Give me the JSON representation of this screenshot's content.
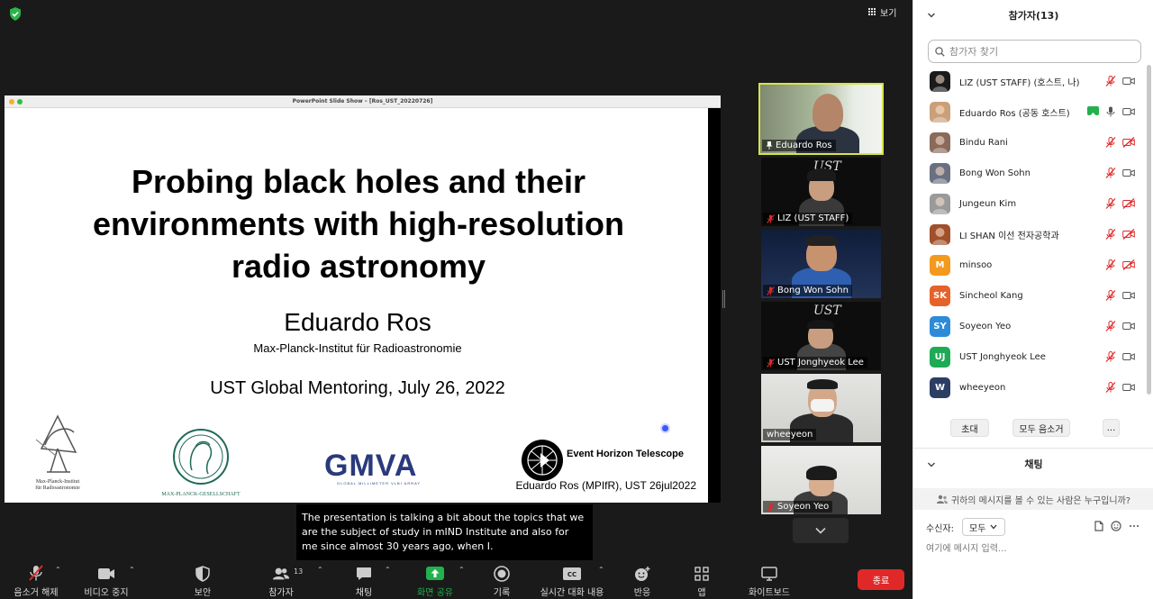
{
  "window": {
    "view_label": "보기"
  },
  "shared_screen": {
    "window_title": "PowerPoint Slide Show – [Ros_UST_20220726]",
    "slide": {
      "title": "Probing black holes and their environments with high-resolution radio astronomy",
      "author": "Eduardo Ros",
      "institute": "Max-Planck-Institut für Radioastronomie",
      "event": "UST Global Mentoring, July 26, 2022",
      "footer": "Eduardo Ros (MPIfR), UST 26jul2022",
      "logo_mpifr": "Max-Planck-Institut\nfür Radioastronomie",
      "logo_mpg": "MAX-PLANCK-GESELLSCHAFT",
      "logo_gmva": "GMVA",
      "logo_gmva_sub": "GLOBAL MILLIMETER VLBI ARRAY",
      "logo_eht": "Event Horizon Telescope"
    }
  },
  "video_tiles": [
    {
      "name": "Eduardo Ros",
      "muted": false,
      "pinned": true
    },
    {
      "name": "LIZ (UST STAFF)",
      "muted": true
    },
    {
      "name": "Bong Won Sohn",
      "muted": true
    },
    {
      "name": "UST Jonghyeok Lee",
      "muted": true
    },
    {
      "name": "wheeyeon",
      "muted": false
    },
    {
      "name": "Soyeon Yeo",
      "muted": true
    }
  ],
  "caption": "The presentation is talking a bit about the topics that we are the subject of study in mIND Institute and also for me since almost 30 years ago, when I.",
  "toolbar": {
    "mute": "음소거 해제",
    "video": "비디오 중지",
    "security": "보안",
    "participants": "참가자",
    "participants_count": "13",
    "chat": "채팅",
    "share": "화면 공유",
    "record": "기록",
    "live_transcript": "실시간 대화 내용",
    "reactions": "반응",
    "apps": "앱",
    "whiteboard": "화이트보드",
    "end": "종료"
  },
  "panel": {
    "title": "참가자(13)",
    "search_placeholder": "참가자 찾기",
    "participants": [
      {
        "name": "LIZ (UST STAFF) (호스트, 나)",
        "initials": "",
        "color": "#1a1a1a"
      },
      {
        "name": "Eduardo Ros (공동 호스트)",
        "initials": "",
        "color": "#c9a07a"
      },
      {
        "name": "Bindu Rani",
        "initials": "",
        "color": "#8a6a5a"
      },
      {
        "name": "Bong Won Sohn",
        "initials": "",
        "color": "#6a7080"
      },
      {
        "name": "Jungeun Kim",
        "initials": "",
        "color": "#9a9a9a"
      },
      {
        "name": "LI SHAN 이선 전자공학과",
        "initials": "",
        "color": "#a0502a"
      },
      {
        "name": "minsoo",
        "initials": "M",
        "color": "#f39a1e"
      },
      {
        "name": "Sincheol Kang",
        "initials": "SK",
        "color": "#e5622a"
      },
      {
        "name": "Soyeon Yeo",
        "initials": "SY",
        "color": "#2e8bd8"
      },
      {
        "name": "UST Jonghyeok Lee",
        "initials": "UJ",
        "color": "#1faa55"
      },
      {
        "name": "wheeyeon",
        "initials": "W",
        "color": "#2c3e63"
      }
    ],
    "invite_label": "초대",
    "mute_all_label": "모두 음소거",
    "more_label": "...",
    "chat_title": "채팅",
    "privacy_text": "귀하의 메시지를 볼 수 있는 사람은 누구입니까?",
    "to_label": "수신자:",
    "to_value": "모두",
    "input_placeholder": "여기에 메시지 입력..."
  },
  "colors": {
    "active_speaker_border": "#d7e34a",
    "share_green": "#22b14c",
    "end_red": "#e02828",
    "muted_red": "#e02828"
  }
}
